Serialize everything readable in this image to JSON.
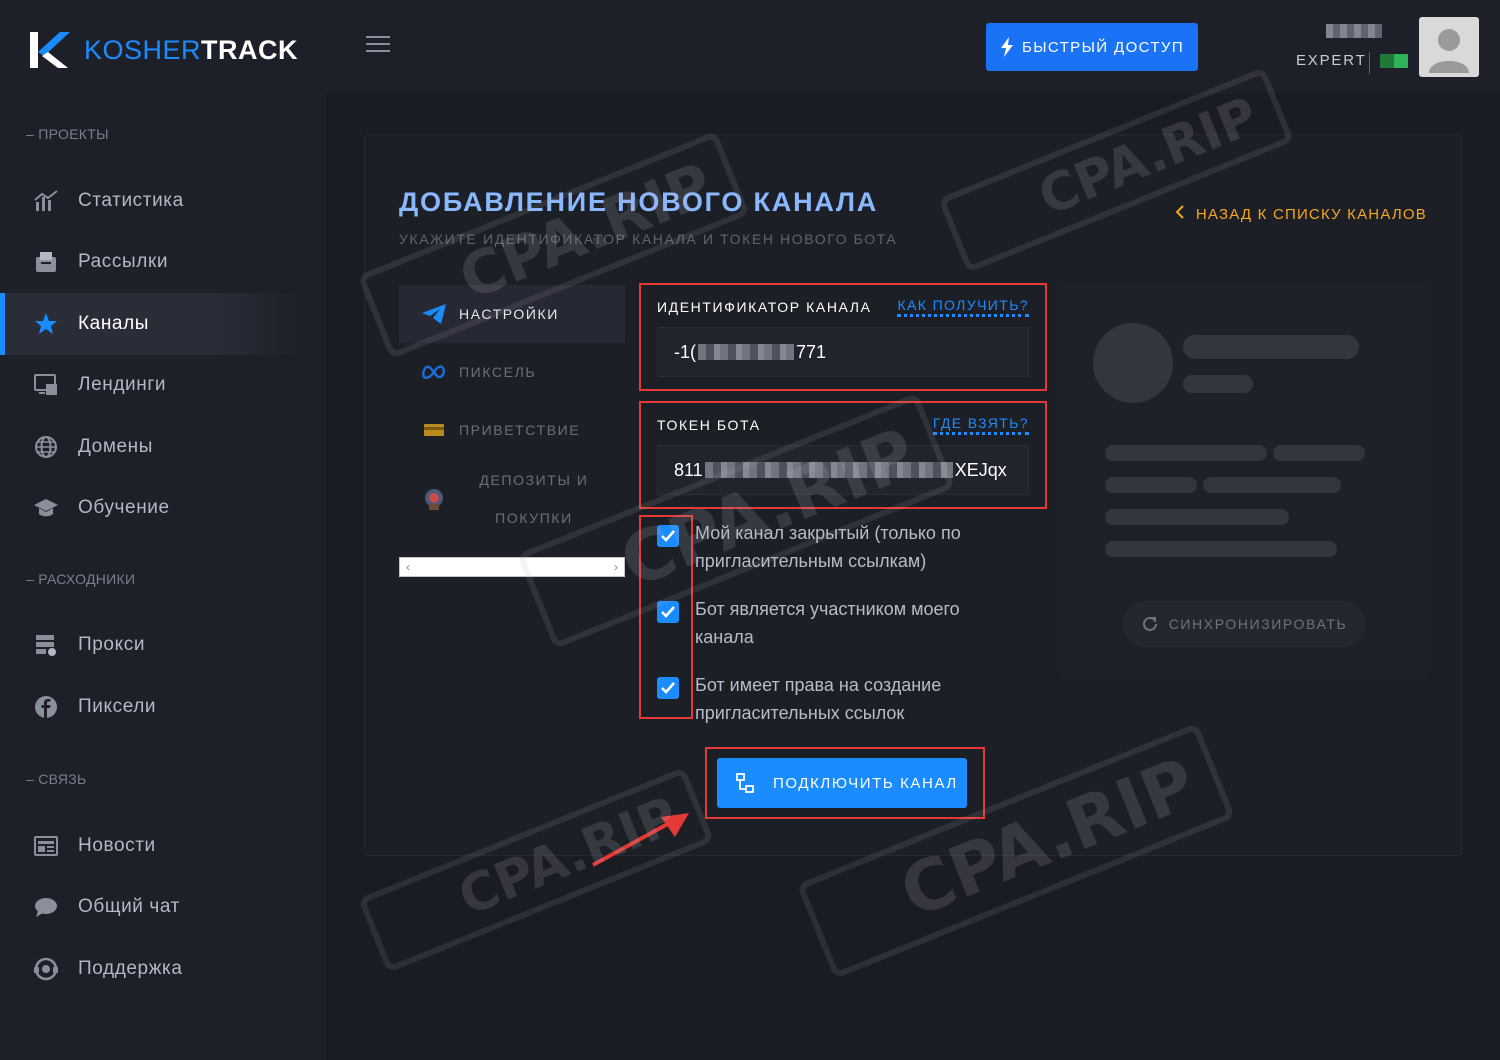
{
  "brand": {
    "name_prefix": "KOSHER",
    "name_suffix": "TRACK"
  },
  "sidebar": {
    "sections": [
      {
        "title": "– ПРОЕКТЫ"
      },
      {
        "title": "– РАСХОДНИКИ"
      },
      {
        "title": "– СВЯЗЬ"
      }
    ],
    "items": [
      {
        "label": "Статистика",
        "icon": "chart-icon"
      },
      {
        "label": "Рассылки",
        "icon": "mailbox-icon"
      },
      {
        "label": "Каналы",
        "icon": "star-icon",
        "active": true
      },
      {
        "label": "Лендинги",
        "icon": "landing-icon"
      },
      {
        "label": "Домены",
        "icon": "globe-icon"
      },
      {
        "label": "Обучение",
        "icon": "graduation-cap-icon"
      },
      {
        "label": "Прокси",
        "icon": "proxy-icon"
      },
      {
        "label": "Пиксели",
        "icon": "facebook-icon"
      },
      {
        "label": "Новости",
        "icon": "news-icon"
      },
      {
        "label": "Общий чат",
        "icon": "chat-icon"
      },
      {
        "label": "Поддержка",
        "icon": "support-icon"
      }
    ]
  },
  "header": {
    "quick_access_label": "БЫСТРЫЙ ДОСТУП",
    "user_plan": "EXPERT"
  },
  "page": {
    "title": "ДОБАВЛЕНИЕ НОВОГО КАНАЛА",
    "subtitle": "УКАЖИТЕ ИДЕНТИФИКАТОР КАНАЛА И ТОКЕН НОВОГО БОТА",
    "back_link": "НАЗАД К СПИСКУ КАНАЛОВ"
  },
  "tabs": [
    {
      "label": "НАСТРОЙКИ",
      "icon": "telegram-icon",
      "active": true
    },
    {
      "label": "ПИКСЕЛЬ",
      "icon": "meta-icon"
    },
    {
      "label": "ПРИВЕТСТВИЕ",
      "icon": "card-icon"
    },
    {
      "label_line1": "ДЕПОЗИТЫ И",
      "label_line2": "ПОКУПКИ",
      "icon": "bot-icon"
    }
  ],
  "form": {
    "channel_id": {
      "label": "ИДЕНТИФИКАТОР КАНАЛА",
      "help": "КАК ПОЛУЧИТЬ?",
      "value_start": "-1(",
      "value_end": "771"
    },
    "bot_token": {
      "label": "ТОКЕН БОТА",
      "help": "ГДЕ ВЗЯТЬ?",
      "value_start": "811",
      "value_end": "XEJqx"
    },
    "checkboxes": [
      {
        "label": "Мой канал закрытый (только по пригласительным ссылкам)",
        "checked": true
      },
      {
        "label": "Бот является участником моего канала",
        "checked": true
      },
      {
        "label": "Бот имеет права на создание пригласительных ссылок",
        "checked": true
      }
    ],
    "submit_label": "ПОДКЛЮЧИТЬ КАНАЛ"
  },
  "preview": {
    "sync_label": "СИНХРОНИЗИРОВАТЬ"
  },
  "watermark": "CPA.RIP",
  "colors": {
    "accent": "#1a8cff",
    "highlight": "#e53935",
    "back_link": "#f5a623"
  }
}
